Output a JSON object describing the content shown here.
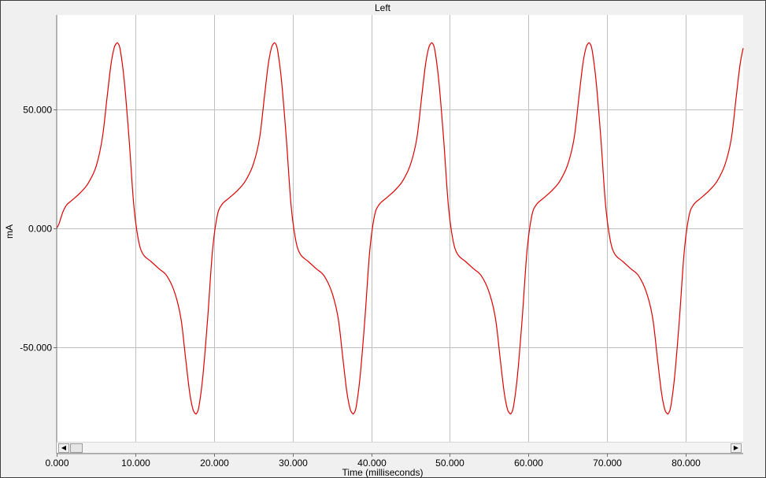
{
  "chart_data": {
    "type": "line",
    "title": "Left",
    "xlabel": "Time (milliseconds)",
    "ylabel": "mA",
    "xlim": [
      0,
      87.3
    ],
    "ylim": [
      -95,
      90
    ],
    "xticks": [
      {
        "value": 0,
        "label": "0.000"
      },
      {
        "value": 10,
        "label": "10.000"
      },
      {
        "value": 20,
        "label": "20.000"
      },
      {
        "value": 30,
        "label": "30.000"
      },
      {
        "value": 40,
        "label": "40.000"
      },
      {
        "value": 50,
        "label": "50.000"
      },
      {
        "value": 60,
        "label": "60.000"
      },
      {
        "value": 70,
        "label": "70.000"
      },
      {
        "value": 80,
        "label": "80.000"
      }
    ],
    "yticks": [
      {
        "value": 50,
        "label": "50.000"
      },
      {
        "value": 0,
        "label": "0.000"
      },
      {
        "value": -50,
        "label": "-50.000"
      }
    ],
    "grid": true,
    "line_color": "#e00000",
    "series": [
      {
        "x": [
          0,
          0.3,
          0.8,
          1.3,
          2,
          3,
          4,
          5,
          5.8,
          6.4,
          6.9,
          7.3,
          7.6,
          7.8,
          8.1,
          8.6,
          9.2,
          9.8,
          10.4,
          11,
          12,
          13,
          14,
          15,
          15.8,
          16.4,
          16.9,
          17.3,
          17.6,
          17.8,
          18.1,
          18.6,
          19.2,
          19.8,
          20.4,
          21,
          22,
          23,
          24,
          25,
          25.8,
          26.4,
          26.9,
          27.3,
          27.6,
          27.8,
          28.1,
          28.6,
          29.2,
          29.8,
          30.4,
          31,
          32,
          33,
          34,
          35,
          35.8,
          36.4,
          36.9,
          37.3,
          37.6,
          37.8,
          38.1,
          38.6,
          39.2,
          39.8,
          40.4,
          41,
          42,
          43,
          44,
          45,
          45.8,
          46.4,
          46.9,
          47.3,
          47.6,
          47.8,
          48.1,
          48.6,
          49.2,
          49.8,
          50.4,
          51,
          52,
          53,
          54,
          55,
          55.8,
          56.4,
          56.9,
          57.3,
          57.6,
          57.8,
          58.1,
          58.6,
          59.2,
          59.8,
          60.4,
          61,
          62,
          63,
          64,
          65,
          65.8,
          66.4,
          66.9,
          67.3,
          67.6,
          67.8,
          68.1,
          68.6,
          69.2,
          69.8,
          70.4,
          71,
          72,
          73,
          74,
          75,
          75.8,
          76.4,
          76.9,
          77.3,
          77.6,
          77.8,
          78.1,
          78.6,
          79.2,
          79.8,
          80.4,
          81,
          82,
          83,
          84,
          85,
          85.8,
          86.4,
          86.9,
          87.3
        ],
        "y": [
          0,
          2,
          7,
          10,
          12,
          15,
          19,
          26,
          38,
          55,
          69,
          76,
          78,
          78,
          75,
          62,
          38,
          10,
          -5,
          -11,
          -14,
          -17,
          -20,
          -27,
          -38,
          -55,
          -69,
          -76,
          -78,
          -78,
          -75,
          -62,
          -38,
          -10,
          5,
          10,
          13,
          16,
          20,
          27,
          38,
          55,
          69,
          76,
          78,
          78,
          75,
          62,
          38,
          10,
          -5,
          -11,
          -14,
          -17,
          -20,
          -27,
          -38,
          -55,
          -69,
          -76,
          -78,
          -78,
          -75,
          -62,
          -38,
          -10,
          5,
          10,
          13,
          16,
          20,
          27,
          38,
          55,
          69,
          76,
          78,
          78,
          75,
          62,
          38,
          10,
          -5,
          -11,
          -14,
          -17,
          -20,
          -27,
          -38,
          -55,
          -69,
          -76,
          -78,
          -78,
          -75,
          -62,
          -38,
          -10,
          5,
          10,
          13,
          16,
          20,
          27,
          38,
          55,
          69,
          76,
          78,
          78,
          75,
          62,
          38,
          10,
          -5,
          -11,
          -14,
          -17,
          -20,
          -27,
          -38,
          -55,
          -69,
          -76,
          -78,
          -78,
          -75,
          -62,
          -38,
          -10,
          5,
          10,
          13,
          16,
          20,
          27,
          38,
          55,
          69,
          76
        ]
      }
    ]
  },
  "scrollbar": {
    "left_arrow": "◀",
    "right_arrow": "▶"
  }
}
